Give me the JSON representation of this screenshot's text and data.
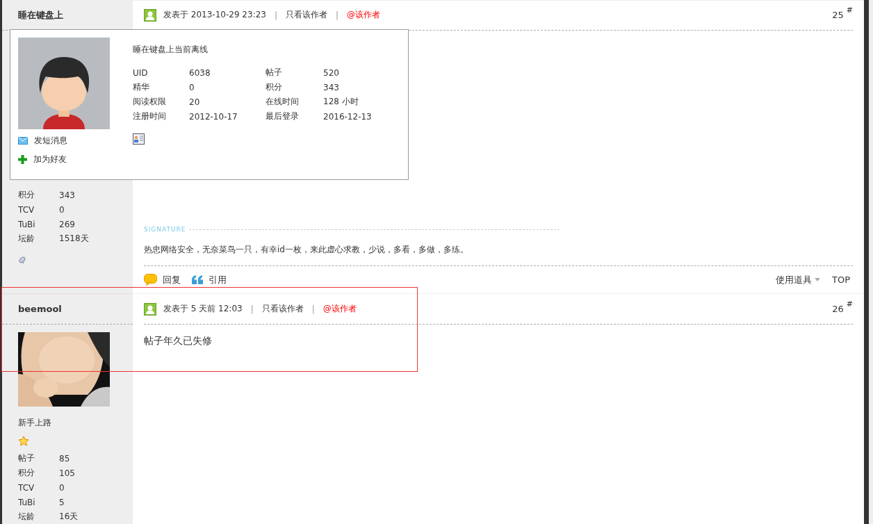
{
  "posts": [
    {
      "author": "睡在键盘上",
      "stats": [
        {
          "label": "积分",
          "value": "343"
        },
        {
          "label": "TCV",
          "value": "0"
        },
        {
          "label": "TuBi",
          "value": "269"
        },
        {
          "label": "坛龄",
          "value": "1518天"
        }
      ],
      "status_icon": true,
      "posted": "发表于 2013-10-29 23:23",
      "separators": [
        "|",
        "|"
      ],
      "only_author": "只看该作者",
      "mention": "@该作者",
      "floor": "25",
      "floor_mark": "#",
      "signature_label": "SIGNATURE",
      "signature": "热忠网络安全，无奈菜鸟一只，有幸id一枚，来此虚心求教，少说，多看，多做，多练。",
      "actions": [
        {
          "label": "回复",
          "kind": "reply"
        },
        {
          "label": "引用",
          "kind": "quote"
        }
      ],
      "tools": "使用道具",
      "top": "TOP"
    },
    {
      "author": "beemool",
      "rank": "新手上路",
      "rank_badge": {
        "kind": "star"
      },
      "stats": [
        {
          "label": "帖子",
          "value": "85"
        },
        {
          "label": "积分",
          "value": "105"
        },
        {
          "label": "TCV",
          "value": "0"
        },
        {
          "label": "TuBi",
          "value": "5"
        },
        {
          "label": "坛龄",
          "value": "16天"
        }
      ],
      "posted": "发表于 5 天前 12:03",
      "separators": [
        "|",
        "|"
      ],
      "only_author": "只看该作者",
      "mention": "@该作者",
      "floor": "26",
      "floor_mark": "#",
      "body": "帖子年久已失修"
    }
  ],
  "profile_popup": {
    "title": "睡在键盘上当前离线",
    "fields": [
      {
        "label": "UID",
        "value": "6038"
      },
      {
        "label": "帖子",
        "value": "520"
      },
      {
        "label": "精华",
        "value": "0"
      },
      {
        "label": "积分",
        "value": "343"
      },
      {
        "label": "阅读权限",
        "value": "20"
      },
      {
        "label": "在线时间",
        "value": "128 小时"
      },
      {
        "label": "注册时间",
        "value": "2012-10-17"
      },
      {
        "label": "最后登录",
        "value": "2016-12-13"
      }
    ],
    "links": [
      {
        "label": "发短消息",
        "kind": "message"
      },
      {
        "label": "加为好友",
        "kind": "add_friend"
      }
    ]
  }
}
